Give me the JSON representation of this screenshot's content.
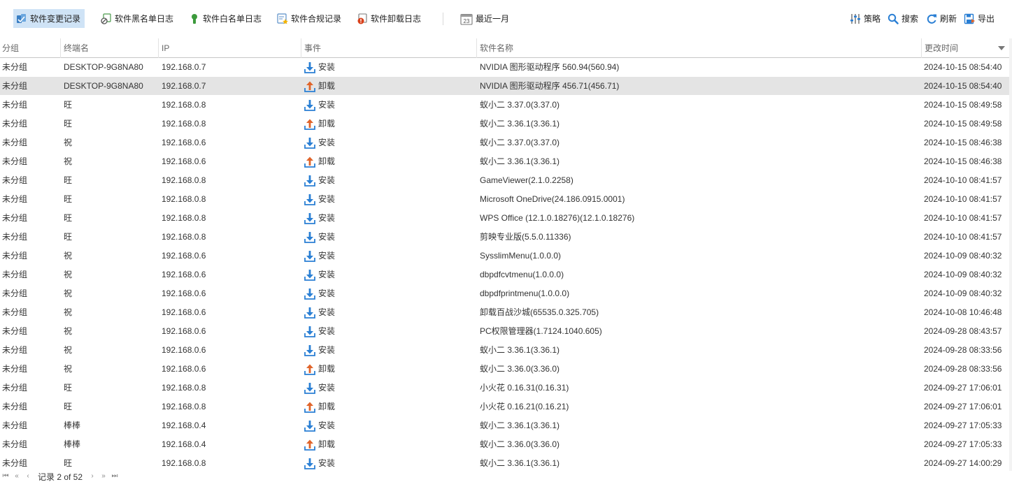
{
  "toolbar": {
    "tabs": [
      {
        "label": "软件变更记录",
        "icon": "software-change-icon",
        "active": true
      },
      {
        "label": "软件黑名单日志",
        "icon": "blacklist-icon",
        "active": false
      },
      {
        "label": "软件白名单日志",
        "icon": "whitelist-icon",
        "active": false
      },
      {
        "label": "软件合规记录",
        "icon": "compliance-icon",
        "active": false
      },
      {
        "label": "软件卸载日志",
        "icon": "uninstall-log-icon",
        "active": false
      }
    ],
    "date_range": {
      "label": "最近一月",
      "icon": "calendar-icon",
      "day": "23"
    },
    "actions": [
      {
        "label": "策略",
        "icon": "sliders-icon"
      },
      {
        "label": "搜索",
        "icon": "search-icon"
      },
      {
        "label": "刷新",
        "icon": "refresh-icon"
      },
      {
        "label": "导出",
        "icon": "export-icon"
      }
    ]
  },
  "table": {
    "columns": [
      "分组",
      "终端名",
      "IP",
      "事件",
      "软件名称",
      "更改时间"
    ],
    "rows": [
      {
        "group": "未分组",
        "terminal": "DESKTOP-9G8NA80",
        "ip": "192.168.0.7",
        "event": "安装",
        "type": "install",
        "software": "NVIDIA 图形驱动程序 560.94(560.94)",
        "time": "2024-10-15 08:54:40",
        "selected": false
      },
      {
        "group": "未分组",
        "terminal": "DESKTOP-9G8NA80",
        "ip": "192.168.0.7",
        "event": "卸载",
        "type": "uninstall",
        "software": "NVIDIA 图形驱动程序 456.71(456.71)",
        "time": "2024-10-15 08:54:40",
        "selected": true
      },
      {
        "group": "未分组",
        "terminal": "旺",
        "ip": "192.168.0.8",
        "event": "安装",
        "type": "install",
        "software": "蚁小二 3.37.0(3.37.0)",
        "time": "2024-10-15 08:49:58",
        "selected": false
      },
      {
        "group": "未分组",
        "terminal": "旺",
        "ip": "192.168.0.8",
        "event": "卸载",
        "type": "uninstall",
        "software": "蚁小二 3.36.1(3.36.1)",
        "time": "2024-10-15 08:49:58",
        "selected": false
      },
      {
        "group": "未分组",
        "terminal": "祝",
        "ip": "192.168.0.6",
        "event": "安装",
        "type": "install",
        "software": "蚁小二 3.37.0(3.37.0)",
        "time": "2024-10-15 08:46:38",
        "selected": false
      },
      {
        "group": "未分组",
        "terminal": "祝",
        "ip": "192.168.0.6",
        "event": "卸载",
        "type": "uninstall",
        "software": "蚁小二 3.36.1(3.36.1)",
        "time": "2024-10-15 08:46:38",
        "selected": false
      },
      {
        "group": "未分组",
        "terminal": "旺",
        "ip": "192.168.0.8",
        "event": "安装",
        "type": "install",
        "software": "GameViewer(2.1.0.2258)",
        "time": "2024-10-10 08:41:57",
        "selected": false
      },
      {
        "group": "未分组",
        "terminal": "旺",
        "ip": "192.168.0.8",
        "event": "安装",
        "type": "install",
        "software": "Microsoft OneDrive(24.186.0915.0001)",
        "time": "2024-10-10 08:41:57",
        "selected": false
      },
      {
        "group": "未分组",
        "terminal": "旺",
        "ip": "192.168.0.8",
        "event": "安装",
        "type": "install",
        "software": "WPS Office (12.1.0.18276)(12.1.0.18276)",
        "time": "2024-10-10 08:41:57",
        "selected": false
      },
      {
        "group": "未分组",
        "terminal": "旺",
        "ip": "192.168.0.8",
        "event": "安装",
        "type": "install",
        "software": "剪映专业版(5.5.0.11336)",
        "time": "2024-10-10 08:41:57",
        "selected": false
      },
      {
        "group": "未分组",
        "terminal": "祝",
        "ip": "192.168.0.6",
        "event": "安装",
        "type": "install",
        "software": "SysslimMenu(1.0.0.0)",
        "time": "2024-10-09 08:40:32",
        "selected": false
      },
      {
        "group": "未分组",
        "terminal": "祝",
        "ip": "192.168.0.6",
        "event": "安装",
        "type": "install",
        "software": "dbpdfcvtmenu(1.0.0.0)",
        "time": "2024-10-09 08:40:32",
        "selected": false
      },
      {
        "group": "未分组",
        "terminal": "祝",
        "ip": "192.168.0.6",
        "event": "安装",
        "type": "install",
        "software": "dbpdfprintmenu(1.0.0.0)",
        "time": "2024-10-09 08:40:32",
        "selected": false
      },
      {
        "group": "未分组",
        "terminal": "祝",
        "ip": "192.168.0.6",
        "event": "安装",
        "type": "install",
        "software": "卸载百战沙城(65535.0.325.705)",
        "time": "2024-10-08 10:46:48",
        "selected": false
      },
      {
        "group": "未分组",
        "terminal": "祝",
        "ip": "192.168.0.6",
        "event": "安装",
        "type": "install",
        "software": "PC权限管理器(1.7124.1040.605)",
        "time": "2024-09-28 08:43:57",
        "selected": false
      },
      {
        "group": "未分组",
        "terminal": "祝",
        "ip": "192.168.0.6",
        "event": "安装",
        "type": "install",
        "software": "蚁小二 3.36.1(3.36.1)",
        "time": "2024-09-28 08:33:56",
        "selected": false
      },
      {
        "group": "未分组",
        "terminal": "祝",
        "ip": "192.168.0.6",
        "event": "卸载",
        "type": "uninstall",
        "software": "蚁小二 3.36.0(3.36.0)",
        "time": "2024-09-28 08:33:56",
        "selected": false
      },
      {
        "group": "未分组",
        "terminal": "旺",
        "ip": "192.168.0.8",
        "event": "安装",
        "type": "install",
        "software": "小火花 0.16.31(0.16.31)",
        "time": "2024-09-27 17:06:01",
        "selected": false
      },
      {
        "group": "未分组",
        "terminal": "旺",
        "ip": "192.168.0.8",
        "event": "卸载",
        "type": "uninstall",
        "software": "小火花 0.16.21(0.16.21)",
        "time": "2024-09-27 17:06:01",
        "selected": false
      },
      {
        "group": "未分组",
        "terminal": "棒棒",
        "ip": "192.168.0.4",
        "event": "安装",
        "type": "install",
        "software": "蚁小二 3.36.1(3.36.1)",
        "time": "2024-09-27 17:05:33",
        "selected": false
      },
      {
        "group": "未分组",
        "terminal": "棒棒",
        "ip": "192.168.0.4",
        "event": "卸载",
        "type": "uninstall",
        "software": "蚁小二 3.36.0(3.36.0)",
        "time": "2024-09-27 17:05:33",
        "selected": false
      },
      {
        "group": "未分组",
        "terminal": "旺",
        "ip": "192.168.0.8",
        "event": "安装",
        "type": "install",
        "software": "蚁小二 3.36.1(3.36.1)",
        "time": "2024-09-27 14:00:29",
        "selected": false
      }
    ]
  },
  "pagination": {
    "text": "记录 2 of 52"
  },
  "colors": {
    "accent_active": "#cfe3f6",
    "install_blue": "#2a7fd4",
    "uninstall_orange": "#e0642a",
    "selected_row": "#e4e4e4"
  }
}
